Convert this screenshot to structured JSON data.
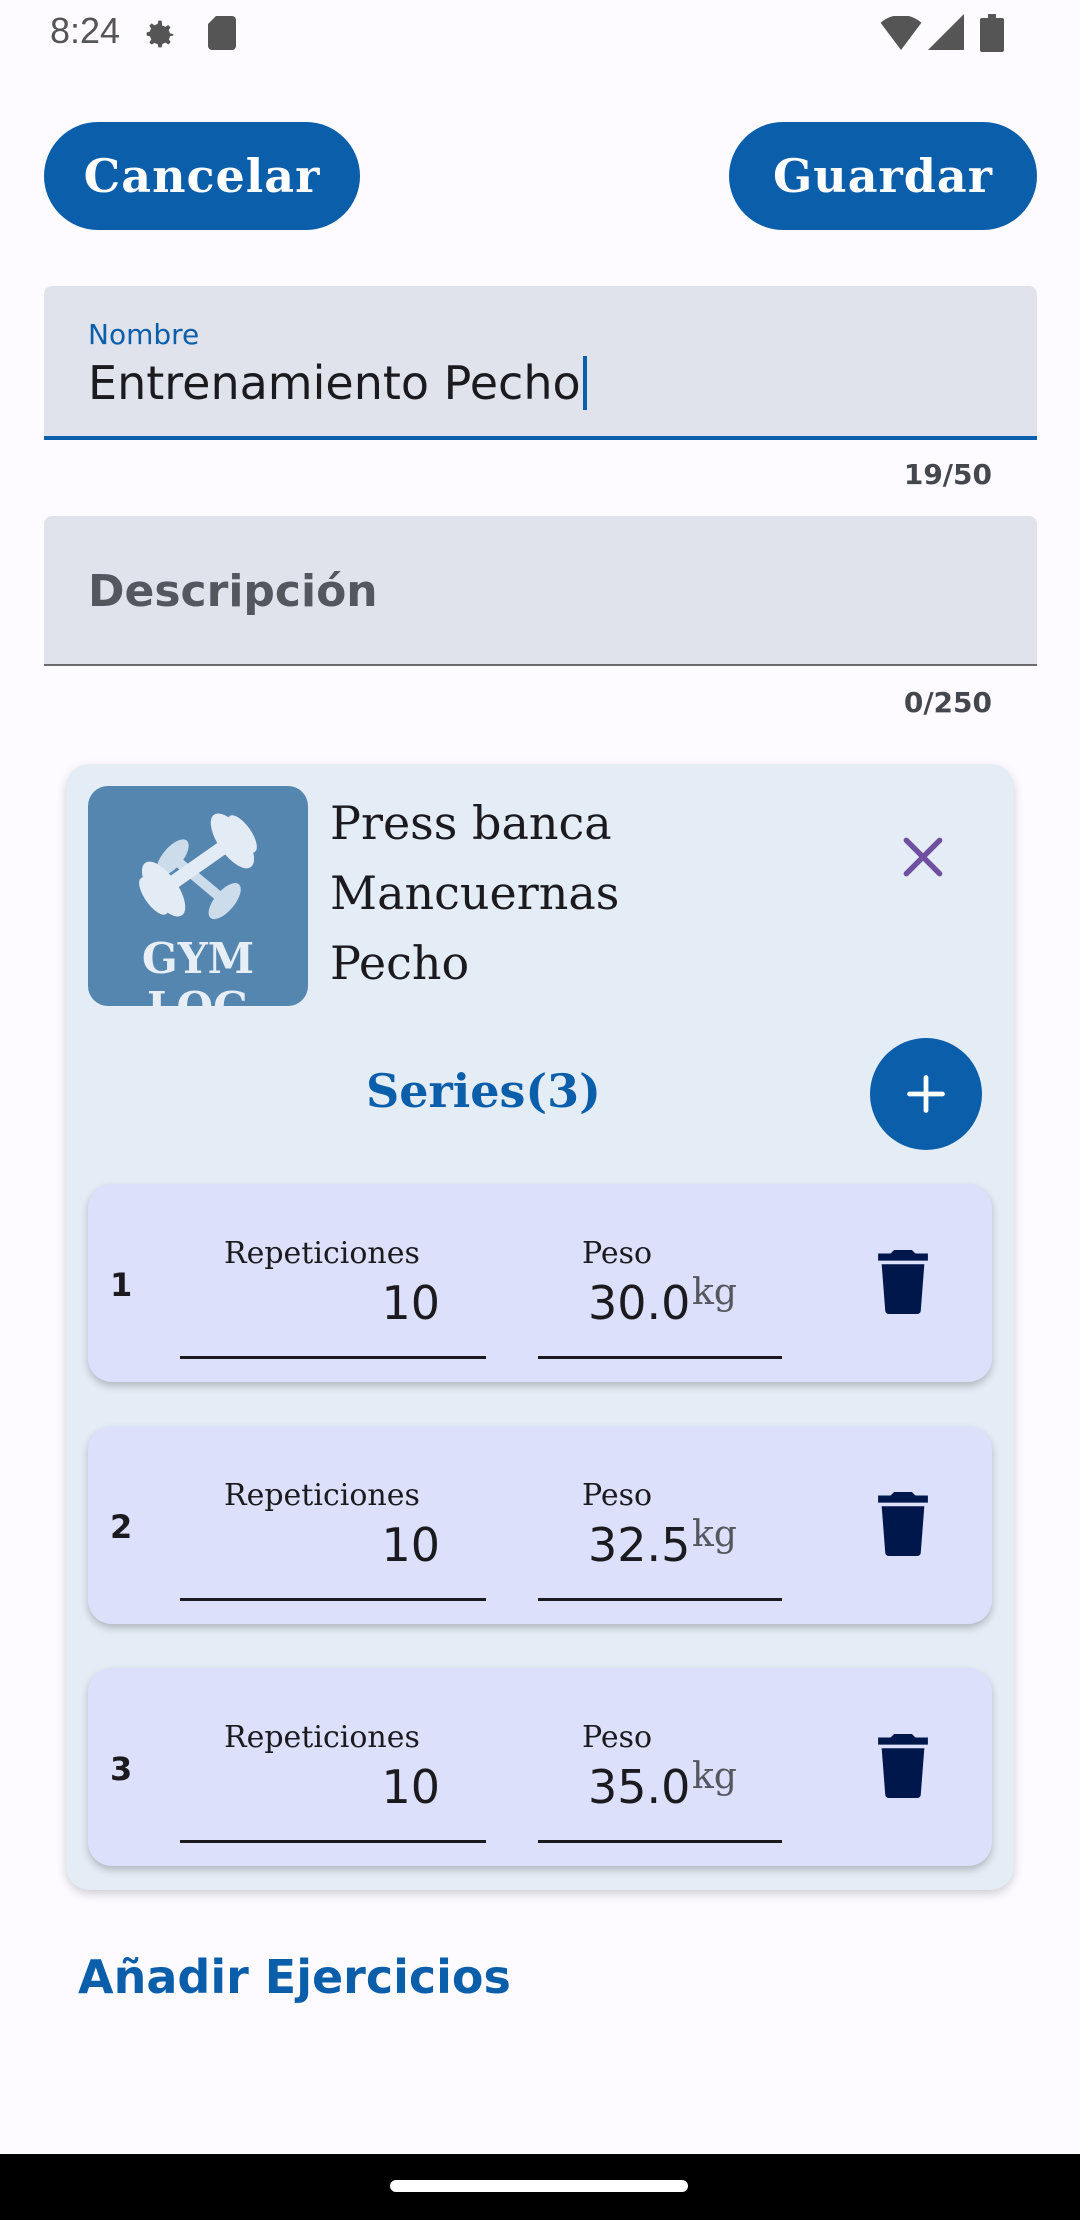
{
  "status_bar": {
    "time": "8:24",
    "icons": [
      "gear-icon",
      "sd-card-icon",
      "wifi-icon",
      "signal-icon",
      "battery-icon"
    ]
  },
  "toolbar": {
    "cancel_label": "Cancelar",
    "save_label": "Guardar"
  },
  "name_field": {
    "label": "Nombre",
    "value": "Entrenamiento Pecho",
    "counter": "19/50"
  },
  "description_field": {
    "placeholder": "Descripción",
    "counter": "0/250"
  },
  "exercise": {
    "thumbnail_text": "GYM LOG",
    "name": "Press banca",
    "equipment": "Mancuernas",
    "muscle": "Pecho",
    "series_title": "Series(3)",
    "sets": [
      {
        "number": "1",
        "reps_label": "Repeticiones",
        "reps": "10",
        "weight_label": "Peso",
        "weight": "30.0",
        "unit": "kg"
      },
      {
        "number": "2",
        "reps_label": "Repeticiones",
        "reps": "10",
        "weight_label": "Peso",
        "weight": "32.5",
        "unit": "kg"
      },
      {
        "number": "3",
        "reps_label": "Repeticiones",
        "reps": "10",
        "weight_label": "Peso",
        "weight": "35.0",
        "unit": "kg"
      }
    ]
  },
  "add_exercises_label": "Añadir Ejercicios",
  "colors": {
    "primary": "#0b5eaa",
    "card_bg": "#e4ecf5",
    "set_bg": "#dde0fb",
    "field_bg": "#e0e2ec",
    "trash": "#00174b",
    "remove_icon": "#6e4fa0"
  }
}
